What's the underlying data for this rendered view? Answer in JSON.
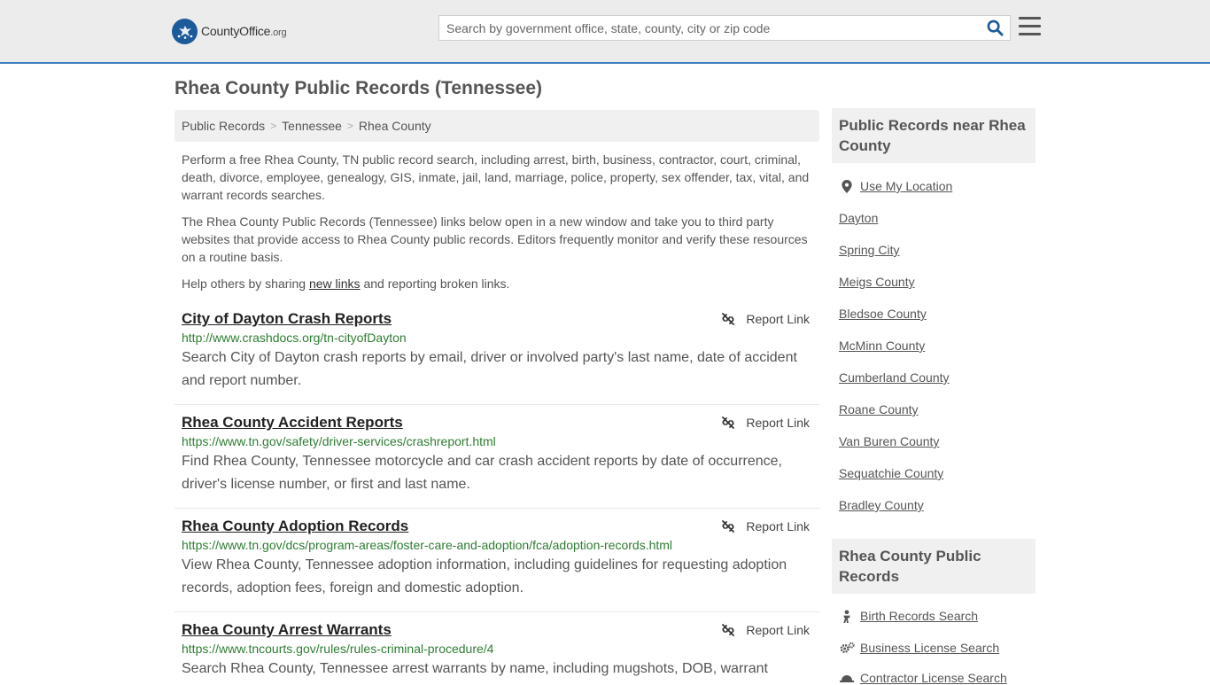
{
  "header": {
    "logo_name": "CountyOffice",
    "logo_tld": ".org",
    "search_placeholder": "Search by government office, state, county, city or zip code",
    "search_icon": "search-icon",
    "menu_icon": "hamburger-menu-icon"
  },
  "page_title": "Rhea County Public Records (Tennessee)",
  "breadcrumb": [
    {
      "label": "Public Records"
    },
    {
      "label": "Tennessee"
    },
    {
      "label": "Rhea County"
    }
  ],
  "intro": {
    "p1": "Perform a free Rhea County, TN public record search, including arrest, birth, business, contractor, court, criminal, death, divorce, employee, genealogy, GIS, inmate, jail, land, marriage, police, property, sex offender, tax, vital, and warrant records searches.",
    "p2": "The Rhea County Public Records (Tennessee) links below open in a new window and take you to third party websites that provide access to Rhea County public records. Editors frequently monitor and verify these resources on a routine basis.",
    "p3_before": "Help others by sharing ",
    "p3_link": "new links",
    "p3_after": " and reporting broken links."
  },
  "report_label": "Report Link",
  "listings": [
    {
      "title": "City of Dayton Crash Reports",
      "url": "http://www.crashdocs.org/tn-cityofDayton",
      "desc": "Search City of Dayton crash reports by email, driver or involved party's last name, date of accident and report number."
    },
    {
      "title": "Rhea County Accident Reports",
      "url": "https://www.tn.gov/safety/driver-services/crashreport.html",
      "desc": "Find Rhea County, Tennessee motorcycle and car crash accident reports by date of occurrence, driver's license number, or first and last name."
    },
    {
      "title": "Rhea County Adoption Records",
      "url": "https://www.tn.gov/dcs/program-areas/foster-care-and-adoption/fca/adoption-records.html",
      "desc": "View Rhea County, Tennessee adoption information, including guidelines for requesting adoption records, adoption fees, foreign and domestic adoption."
    },
    {
      "title": "Rhea County Arrest Warrants",
      "url": "https://www.tncourts.gov/rules/rules-criminal-procedure/4",
      "desc": "Search Rhea County, Tennessee arrest warrants by name, including mugshots, DOB, warrant"
    }
  ],
  "sidebar": {
    "near_heading": "Public Records near Rhea County",
    "use_location": "Use My Location",
    "near_links": [
      "Dayton",
      "Spring City",
      "Meigs County",
      "Bledsoe County",
      "McMinn County",
      "Cumberland County",
      "Roane County",
      "Van Buren County",
      "Sequatchie County",
      "Bradley County"
    ],
    "records_heading": "Rhea County Public Records",
    "record_links": [
      {
        "label": "Birth Records Search",
        "icon": "baby-icon"
      },
      {
        "label": "Business License Search",
        "icon": "gears-icon"
      },
      {
        "label": "Contractor License Search",
        "icon": "hardhat-icon"
      }
    ]
  },
  "colors": {
    "header_bg": "#ececec",
    "header_border": "#3b7dbf",
    "url_green": "#2e7d32",
    "search_icon": "#1d5a9a"
  }
}
